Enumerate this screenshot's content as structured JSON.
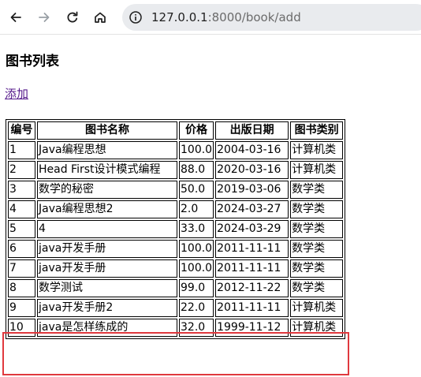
{
  "browser": {
    "url_host": "127.0.0.1",
    "url_rest": ":8000/book/add"
  },
  "page": {
    "title": "图书列表",
    "add_link": "添加"
  },
  "table": {
    "headers": [
      "编号",
      "图书名称",
      "价格",
      "出版日期",
      "图书类别"
    ],
    "rows": [
      [
        "1",
        "Java编程思想",
        "100.0",
        "2004-03-16",
        "计算机类"
      ],
      [
        "2",
        "Head First设计模式编程",
        "88.0",
        "2020-03-16",
        "计算机类"
      ],
      [
        "3",
        "数学的秘密",
        "50.0",
        "2019-03-06",
        "数学类"
      ],
      [
        "4",
        "Java编程思想2",
        "2.0",
        "2024-03-27",
        "数学类"
      ],
      [
        "5",
        "4",
        "33.0",
        "2024-03-29",
        "数学类"
      ],
      [
        "6",
        "java开发手册",
        "100.0",
        "2011-11-11",
        "数学类"
      ],
      [
        "7",
        "java开发手册",
        "100.0",
        "2011-11-11",
        "数学类"
      ],
      [
        "8",
        "数学测试",
        "99.0",
        "2012-11-22",
        "数学类"
      ],
      [
        "9",
        "java开发手册2",
        "22.0",
        "2011-11-11",
        "计算机类"
      ],
      [
        "10",
        "java是怎样练成的",
        "32.0",
        "1999-11-12",
        "计算机类"
      ]
    ]
  },
  "colors": {
    "highlight": "#e0393e",
    "visited_link": "#551a8b"
  }
}
